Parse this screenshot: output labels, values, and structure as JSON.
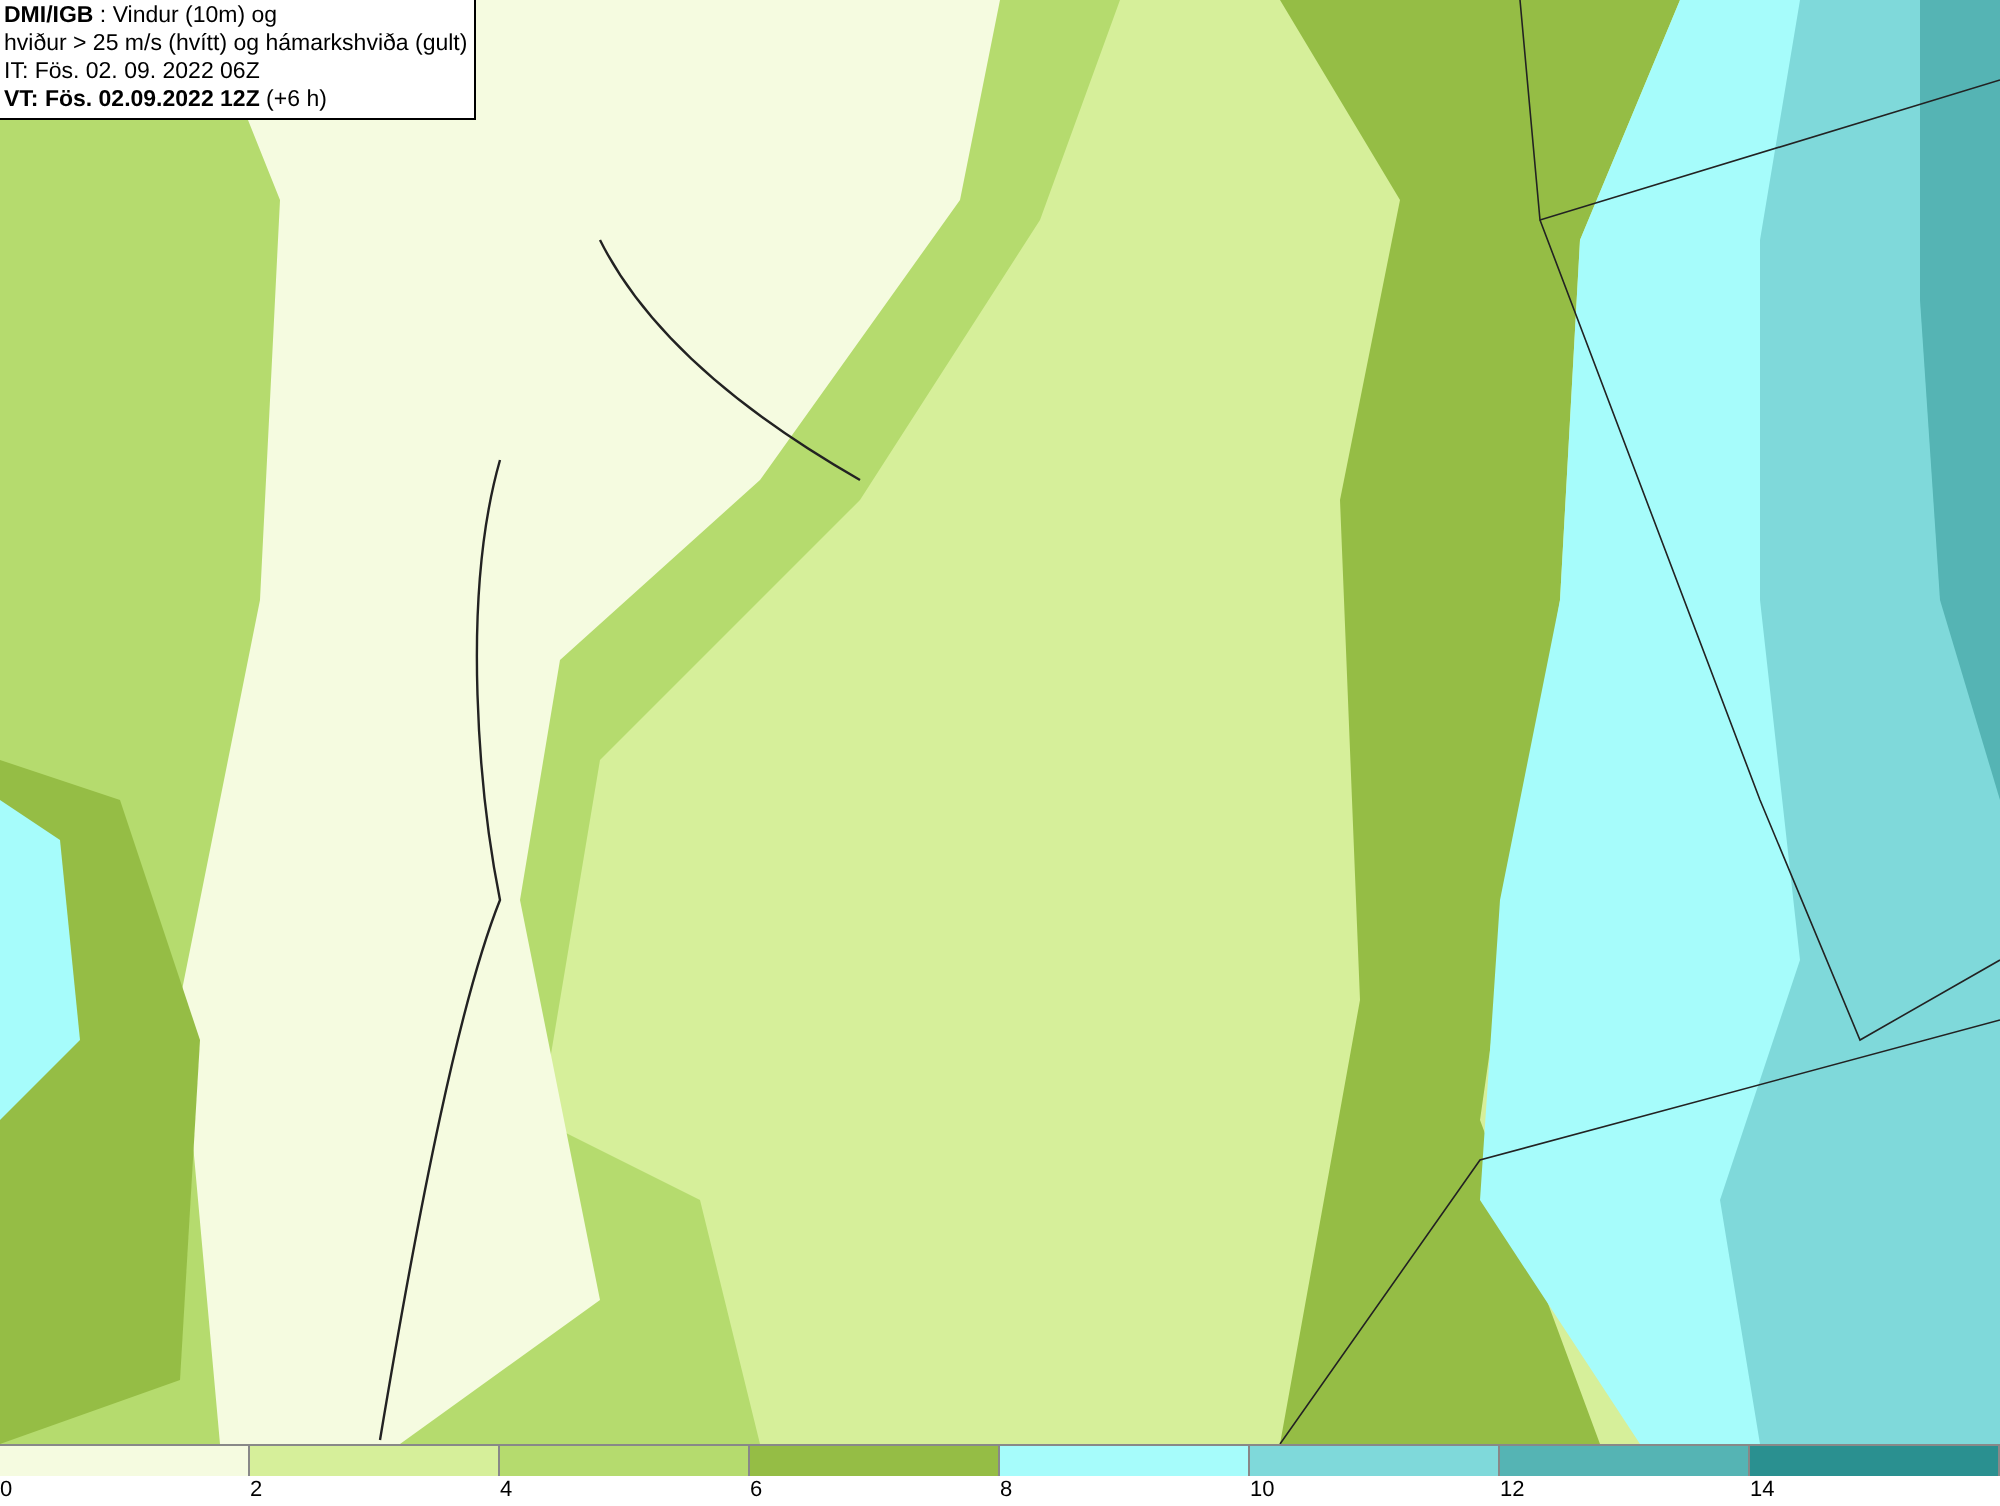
{
  "title_box": {
    "lines": [
      "**DMI/IGB** : Vindur (10m) og",
      "hviður > 25 m/s (hvítt) og hámarkshviða (gult)",
      "IT: Fös. 02. 09. 2022 06Z",
      "**VT: Fös. 02.09.2022 12Z** (+6 h)"
    ]
  },
  "legend": {
    "bins": [
      {
        "label": "0",
        "color": "#f5fbe0"
      },
      {
        "label": "2",
        "color": "#d6ef9a"
      },
      {
        "label": "4",
        "color": "#b5db6e"
      },
      {
        "label": "6",
        "color": "#95bd45"
      },
      {
        "label": "8",
        "color": "#a6fcfb"
      },
      {
        "label": "10",
        "color": "#7fd9da"
      },
      {
        "label": "12",
        "color": "#55b4b4"
      },
      {
        "label": "14",
        "color": "#2a9090"
      }
    ]
  }
}
